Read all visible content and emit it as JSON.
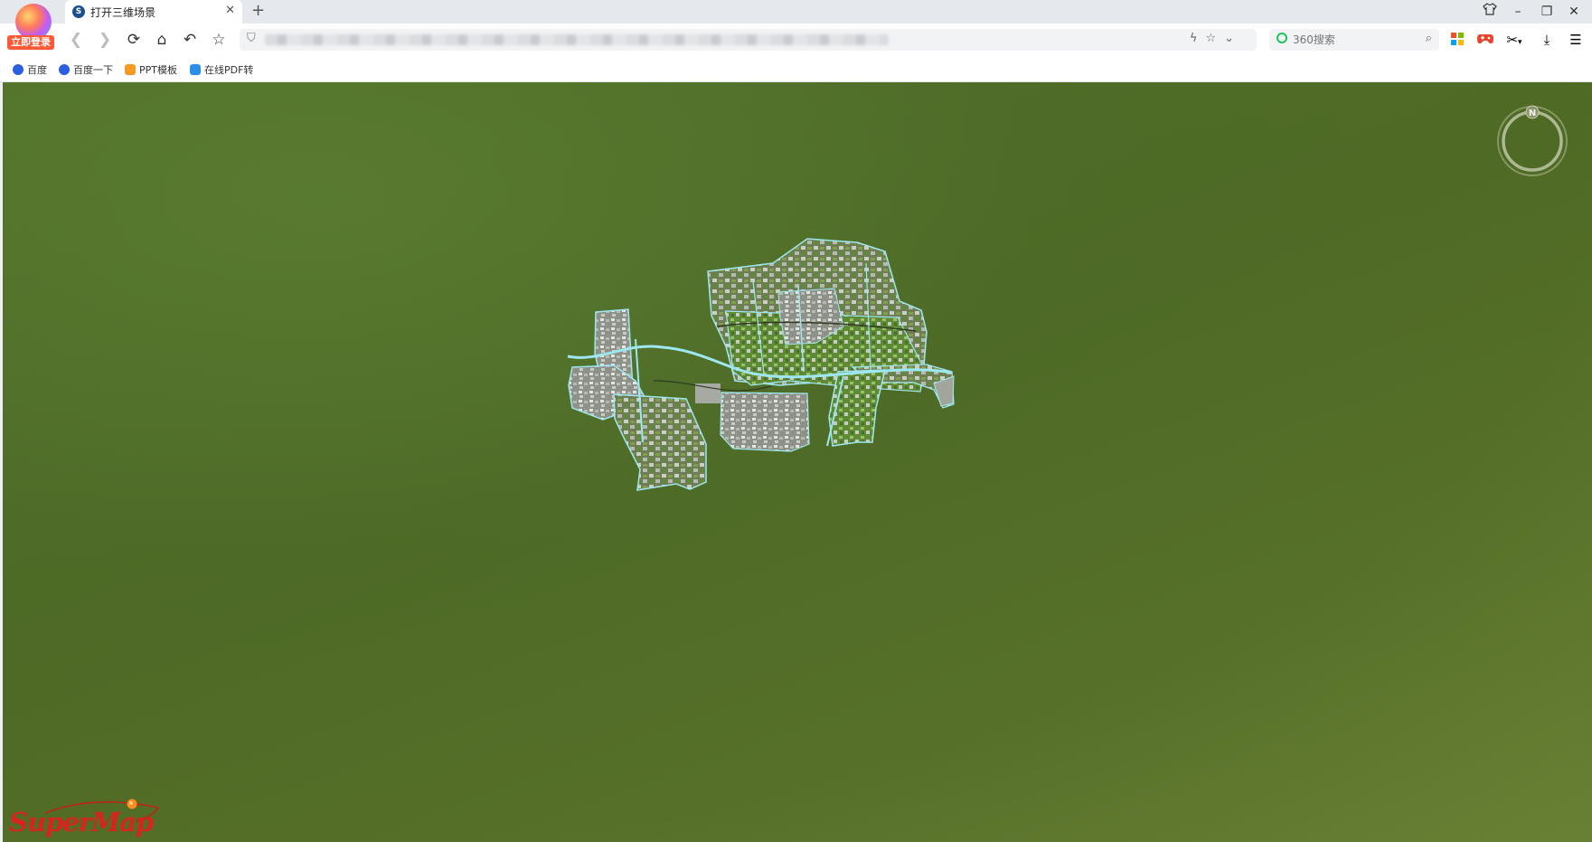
{
  "browser": {
    "login_badge": "立即登录",
    "tab": {
      "title": "打开三维场景",
      "favicon_letter": "S"
    },
    "search": {
      "placeholder": "360搜索"
    }
  },
  "bookmarks": [
    {
      "label": "百度",
      "icon": "baidu-paw-icon",
      "color": "#2c5fe0"
    },
    {
      "label": "百度一下",
      "icon": "baidu-paw-icon",
      "color": "#2c5fe0"
    },
    {
      "label": "PPT模板",
      "icon": "ppt-icon",
      "color": "#f59a23"
    },
    {
      "label": "在线PDF转",
      "icon": "pdf-convert-icon",
      "color": "#2d8ee8"
    }
  ],
  "scene": {
    "compass_label": "N",
    "brand": "SuperMap",
    "background_color": "#4f6b25",
    "road_color": "#9ee7f0"
  }
}
